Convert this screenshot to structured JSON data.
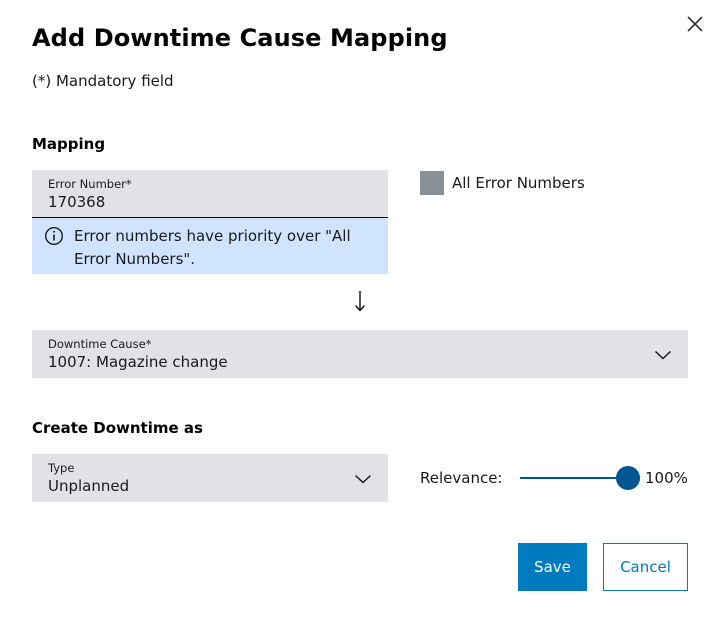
{
  "dialog": {
    "title": "Add Downtime Cause Mapping",
    "mandatory_note": "(*) Mandatory field",
    "close_icon": "close-icon"
  },
  "mapping": {
    "heading": "Mapping",
    "error_number": {
      "label": "Error Number*",
      "value": "170368"
    },
    "info": {
      "icon": "info-icon",
      "text": "Error numbers have priority over \"All Error Numbers\"."
    },
    "all_error_numbers": {
      "label": "All Error Numbers",
      "checked": false
    },
    "arrow_icon": "arrow-down-icon",
    "downtime_cause": {
      "label": "Downtime Cause*",
      "value": "1007: Magazine change"
    }
  },
  "create_downtime": {
    "heading": "Create Downtime as",
    "type": {
      "label": "Type",
      "value": "Unplanned"
    },
    "relevance": {
      "label": "Relevance:",
      "value_text": "100%",
      "value": 100
    }
  },
  "actions": {
    "save_label": "Save",
    "cancel_label": "Cancel"
  },
  "colors": {
    "accent": "#007bc0",
    "slider": "#005691",
    "field_bg": "#e0e2e5",
    "info_bg": "#d1e4ff",
    "checkbox": "#8a9097"
  }
}
